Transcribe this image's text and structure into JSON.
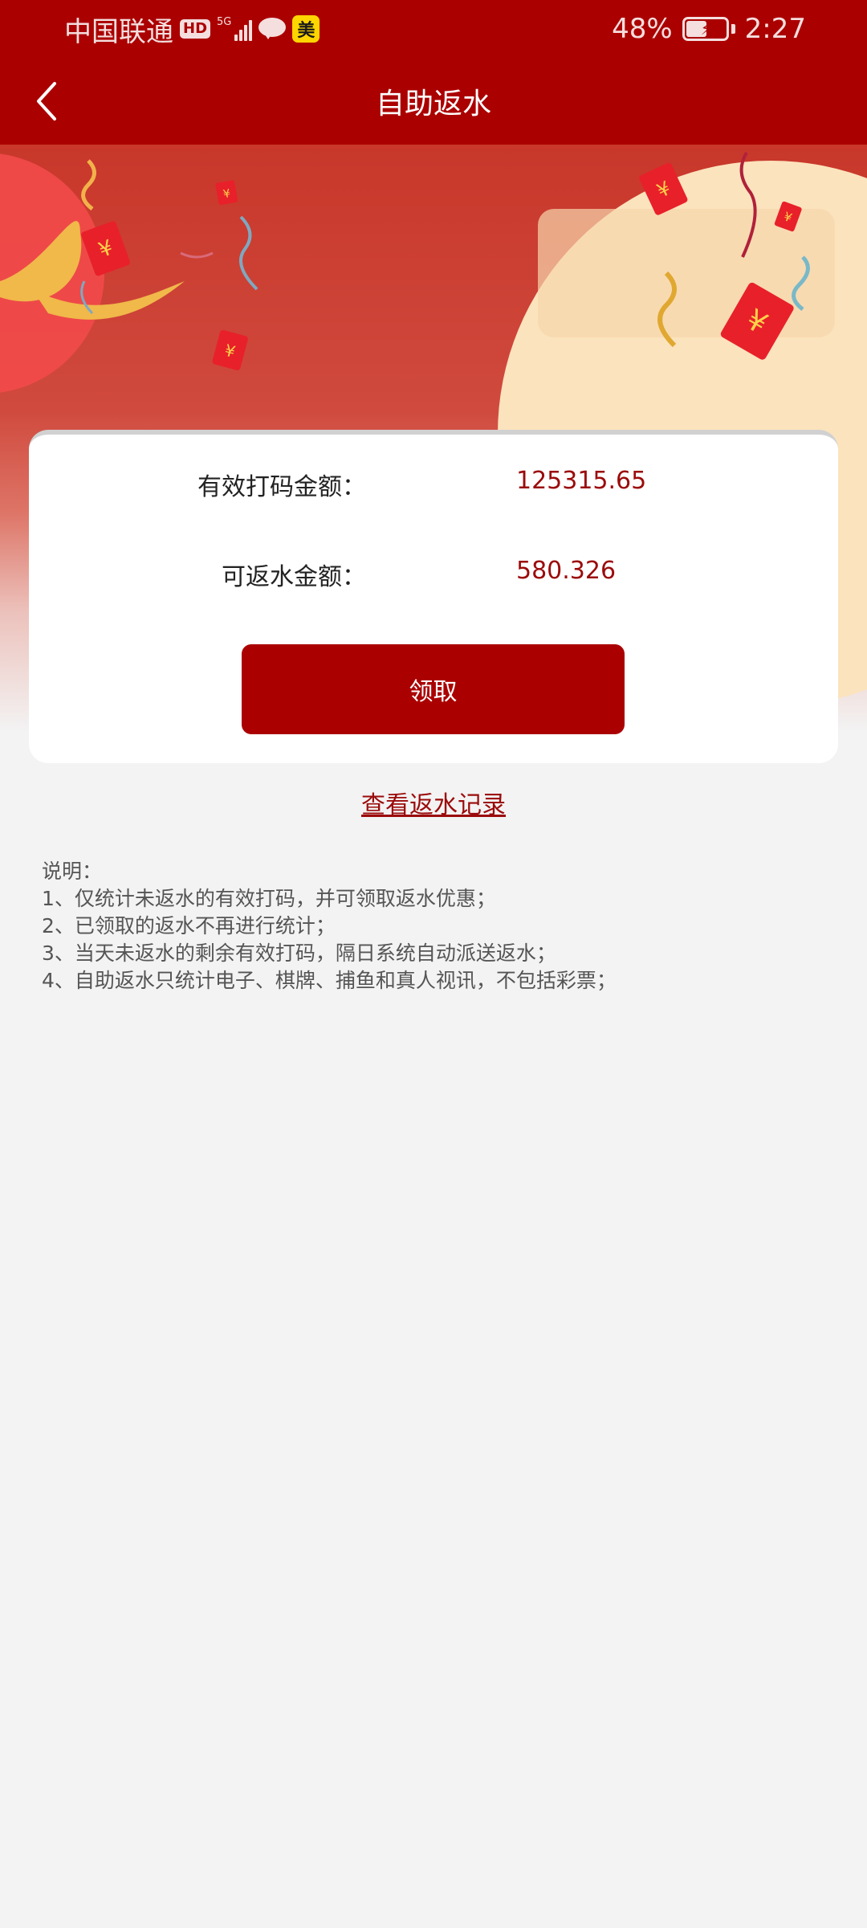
{
  "status_bar": {
    "carrier": "中国联通",
    "hd_badge": "HD",
    "network": "5G",
    "mei_badge": "美",
    "battery_percent": "48%",
    "time": "2:27",
    "battery_level": 0.48
  },
  "nav": {
    "title": "自助返水"
  },
  "card": {
    "effective_bet_label": "有效打码金额：",
    "effective_bet_value": "125315.65",
    "rebate_label": "可返水金额：",
    "rebate_value": "580.326",
    "claim_button": "领取"
  },
  "record_link": "查看返水记录",
  "notes": {
    "heading": "说明：",
    "items": [
      "1、仅统计未返水的有效打码，并可领取返水优惠；",
      "2、已领取的返水不再进行统计；",
      "3、当天未返水的剩余有效打码，隔日系统自动派送返水；",
      "4、自助返水只统计电子、棋牌、捕鱼和真人视讯，不包括彩票；"
    ]
  },
  "colors": {
    "brand_red": "#ab0000",
    "value_red": "#9b0b0b",
    "page_bg": "#f3f3f3"
  }
}
